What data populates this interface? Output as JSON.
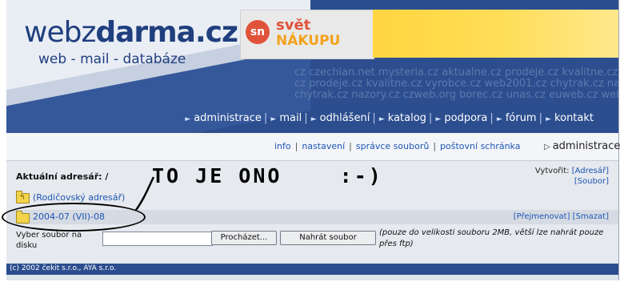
{
  "header": {
    "logo_prefix": "webz",
    "logo_bold": "darma.cz",
    "logo_tagline": "web - mail - databáze",
    "banner": {
      "circle": "sn",
      "line1": "svět",
      "line2": "NÁKUPU"
    },
    "watermark_lines": [
      "cz czechian.net mysteria.cz aktualne.cz prodeje.cz kvalitne.cz vyrobce.cz",
      "cz prodeje.cz kvalitne.cz vyrobce.cz web2001.cz chytrak.cz nazory.cz",
      "chytrak.cz nazory.cz czweb.org borec.cz unas.cz euweb.cz webz.cz wz.cz"
    ],
    "nav": [
      "administrace",
      "mail",
      "odhlášení",
      "katalog",
      "podpora",
      "fórum",
      "kontakt"
    ]
  },
  "subnav": {
    "links": [
      "info",
      "nastavení",
      "správce souborů",
      "poštovní schránka"
    ],
    "section": "administrace"
  },
  "content": {
    "current_dir_label": "Aktuální adresář: /",
    "create_label": "Vytvořit:",
    "create_links": [
      "[Adresář]",
      "[Soubor]"
    ],
    "parent_dir": "(Rodičovský adresář)",
    "folder_name": "2004-07 (VII)-08",
    "folder_actions": [
      "[Přejmenovat]",
      "[Smazat]"
    ],
    "scrawl": "TO JE ONO    :-)",
    "upload_label": "Vyber soubor na disku",
    "file_value": "",
    "browse_button": "Procházet...",
    "upload_button": "Nahrát soubor",
    "upload_note": "(pouze do velikosti souboru 2MB, větší lze nahrát pouze přes ftp)"
  },
  "footer": {
    "text": "(c) 2002 čekit s.r.o., AYA s.r.o."
  },
  "colors": {
    "header_blue": "#2c4e8f",
    "link_blue": "#1d56b3",
    "banner_yellow": "#ffd640",
    "content_gray": "#e6e9ee"
  }
}
